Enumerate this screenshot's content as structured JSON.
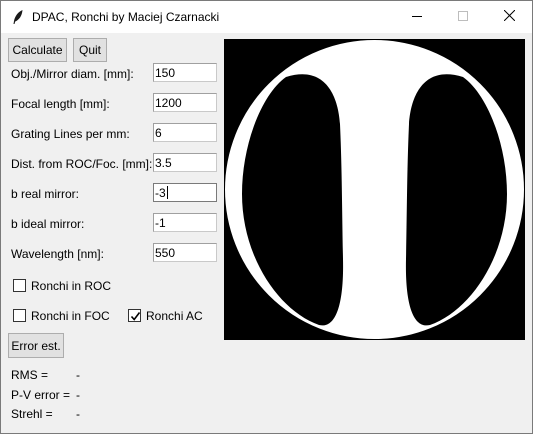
{
  "window": {
    "title": "DPAC, Ronchi by Maciej Czarnacki"
  },
  "toolbar": {
    "calculate_label": "Calculate",
    "quit_label": "Quit"
  },
  "fields": [
    {
      "label": "Obj./Mirror diam. [mm]:",
      "value": "150"
    },
    {
      "label": "Focal length [mm]:",
      "value": "1200"
    },
    {
      "label": "Grating Lines per mm:",
      "value": "6"
    },
    {
      "label": "Dist. from ROC/Foc. [mm]:",
      "value": "3.5"
    },
    {
      "label": "b real mirror:",
      "value": "-3"
    },
    {
      "label": "b ideal mirror:",
      "value": "-1"
    },
    {
      "label": "Wavelength [nm]:",
      "value": "550"
    }
  ],
  "options": {
    "ronchi_roc": {
      "label": "Ronchi in ROC",
      "checked": false
    },
    "ronchi_foc": {
      "label": "Ronchi in FOC",
      "checked": false
    },
    "ronchi_ac": {
      "label": "Ronchi AC",
      "checked": true
    }
  },
  "error_est": {
    "label": "Error est."
  },
  "results": {
    "rms": {
      "label": "RMS =",
      "value": "-"
    },
    "pv": {
      "label": "P-V error =",
      "value": "-"
    },
    "strehl": {
      "label": "Strehl =",
      "value": "-"
    }
  },
  "ronchigram": {
    "background": "#000000",
    "band_color": "#ffffff",
    "outline_color": "#ffffff"
  },
  "icons": {
    "app": "feather-icon",
    "minimize": "minimize-icon",
    "maximize": "maximize-icon",
    "close": "close-icon"
  }
}
